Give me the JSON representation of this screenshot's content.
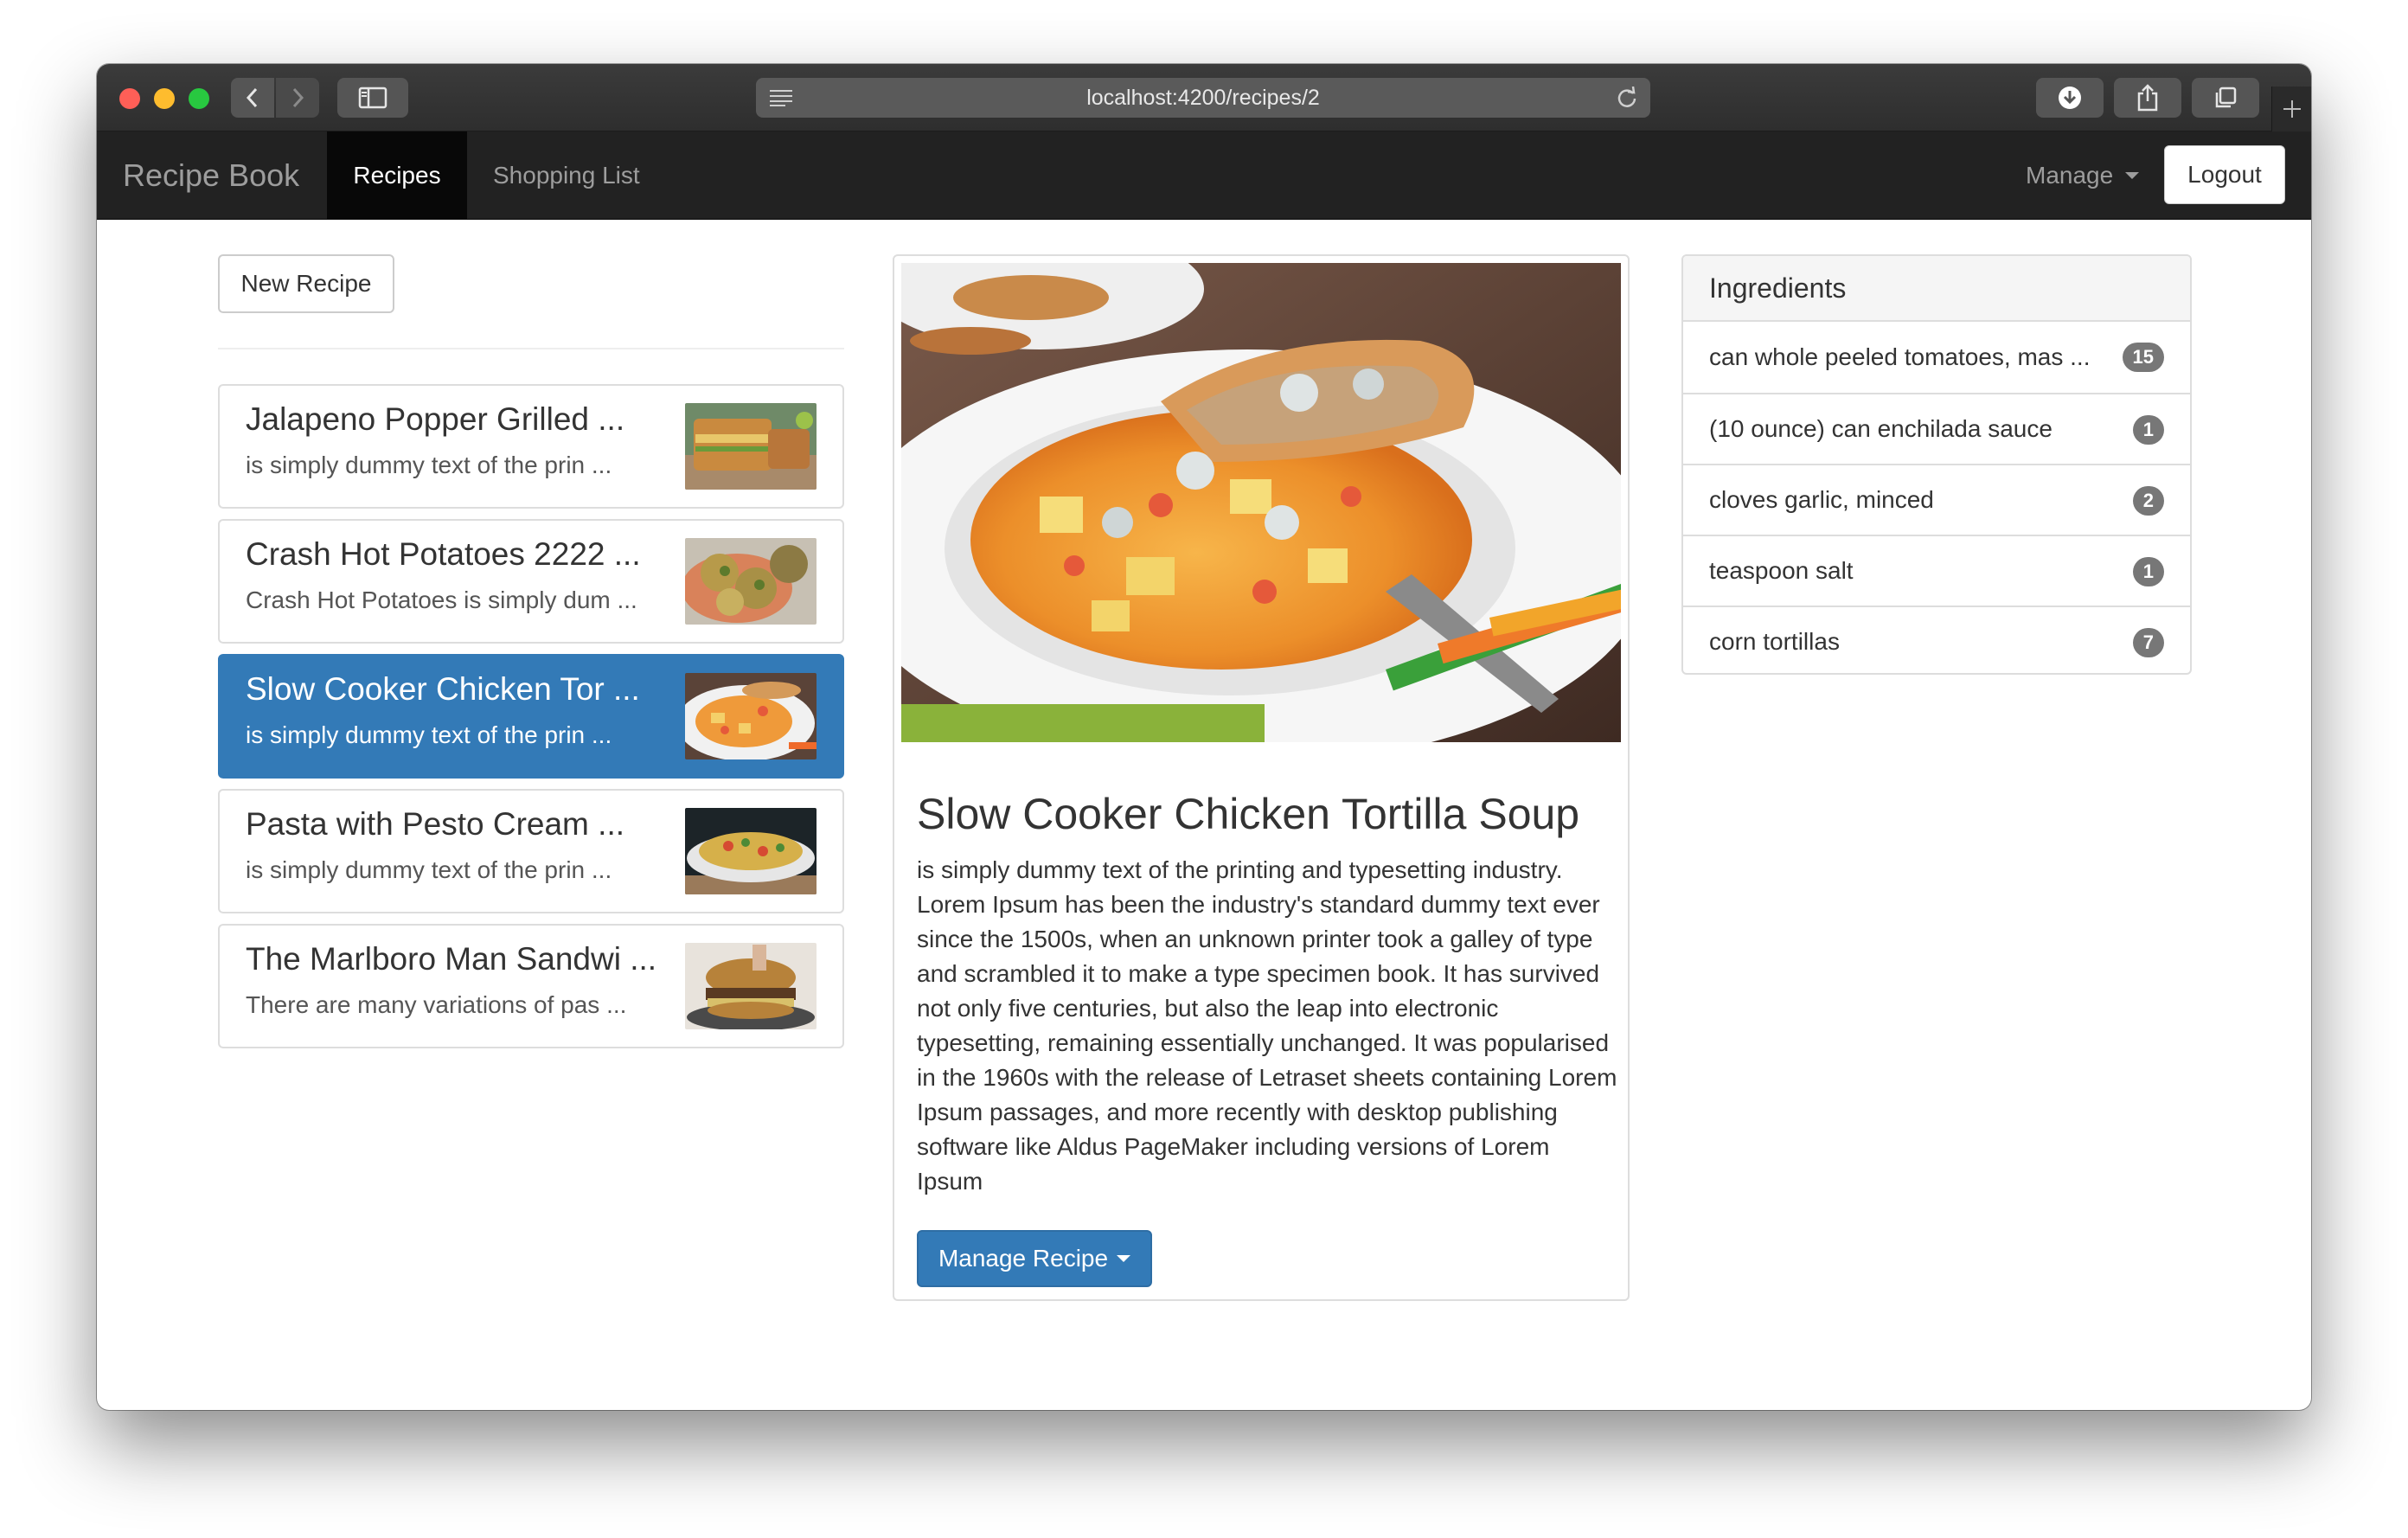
{
  "browser": {
    "address": "localhost:4200/recipes/2"
  },
  "navbar": {
    "brand": "Recipe Book",
    "links": [
      {
        "label": "Recipes",
        "active": true
      },
      {
        "label": "Shopping List",
        "active": false
      }
    ],
    "manage_label": "Manage",
    "logout_label": "Logout"
  },
  "sidebar": {
    "new_recipe_label": "New Recipe",
    "recipes": [
      {
        "name": "Jalapeno Popper Grilled ...",
        "description": "is simply dummy text of the prin ...",
        "active": false
      },
      {
        "name": "Crash Hot Potatoes 2222 ...",
        "description": "Crash Hot Potatoes is simply dum ...",
        "active": false
      },
      {
        "name": "Slow Cooker Chicken Tor ...",
        "description": "is simply dummy text of the prin ...",
        "active": true
      },
      {
        "name": "Pasta with Pesto Cream ...",
        "description": "is simply dummy text of the prin ...",
        "active": false
      },
      {
        "name": "The Marlboro Man Sandwi ...",
        "description": "There are many variations of pas ...",
        "active": false
      }
    ]
  },
  "detail": {
    "title": "Slow Cooker Chicken Tortilla Soup",
    "description": "is simply dummy text of the printing and typesetting industry. Lorem Ipsum has been the industry's standard dummy text ever since the 1500s, when an unknown printer took a galley of type and scrambled it to make a type specimen book. It has survived not only five centuries, but also the leap into electronic typesetting, remaining essentially unchanged. It was popularised in the 1960s with the release of Letraset sheets containing Lorem Ipsum passages, and more recently with desktop publishing software like Aldus PageMaker including versions of Lorem Ipsum",
    "manage_label": "Manage Recipe"
  },
  "ingredients": {
    "heading": "Ingredients",
    "items": [
      {
        "name": "can whole peeled tomatoes, mas ...",
        "amount": "15"
      },
      {
        "name": "(10 ounce) can enchilada sauce",
        "amount": "1"
      },
      {
        "name": "cloves garlic, minced",
        "amount": "2"
      },
      {
        "name": "teaspoon salt",
        "amount": "1"
      },
      {
        "name": "corn tortillas",
        "amount": "7"
      }
    ]
  },
  "colors": {
    "primary": "#337ab7",
    "navbar": "#222222",
    "badge": "#777777"
  }
}
